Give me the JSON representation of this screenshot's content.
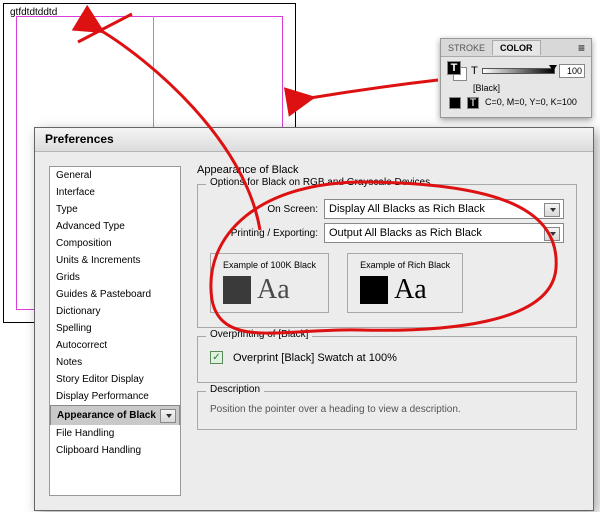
{
  "canvas": {
    "sample_text": "gtfdtdtddtd"
  },
  "color_panel": {
    "tab_stroke": "STROKE",
    "tab_color": "COLOR",
    "t_label": "T",
    "t_value": "100",
    "swatch_name": "[Black]",
    "cmyk": "C=0, M=0, Y=0, K=100"
  },
  "prefs": {
    "title": "Preferences",
    "side": [
      "General",
      "Interface",
      "Type",
      "Advanced Type",
      "Composition",
      "Units & Increments",
      "Grids",
      "Guides & Pasteboard",
      "Dictionary",
      "Spelling",
      "Autocorrect",
      "Notes",
      "Story Editor Display",
      "Display Performance",
      "Appearance of Black",
      "File Handling",
      "Clipboard Handling"
    ],
    "side_selected": "Appearance of Black",
    "heading": "Appearance of Black",
    "fs_options": "Options for Black on RGB and Grayscale Devices",
    "on_screen_label": "On Screen:",
    "on_screen_value": "Display All Blacks as Rich Black",
    "print_label": "Printing / Exporting:",
    "print_value": "Output All Blacks as Rich Black",
    "ex_100k": "Example of 100K Black",
    "ex_rich": "Example of Rich Black",
    "aa": "Aa",
    "fs_op": "Overprinting of [Black]",
    "op_cb": "Overprint [Black] Swatch at 100%",
    "fs_desc": "Description",
    "desc_text": "Position the pointer over a heading to view a description."
  }
}
